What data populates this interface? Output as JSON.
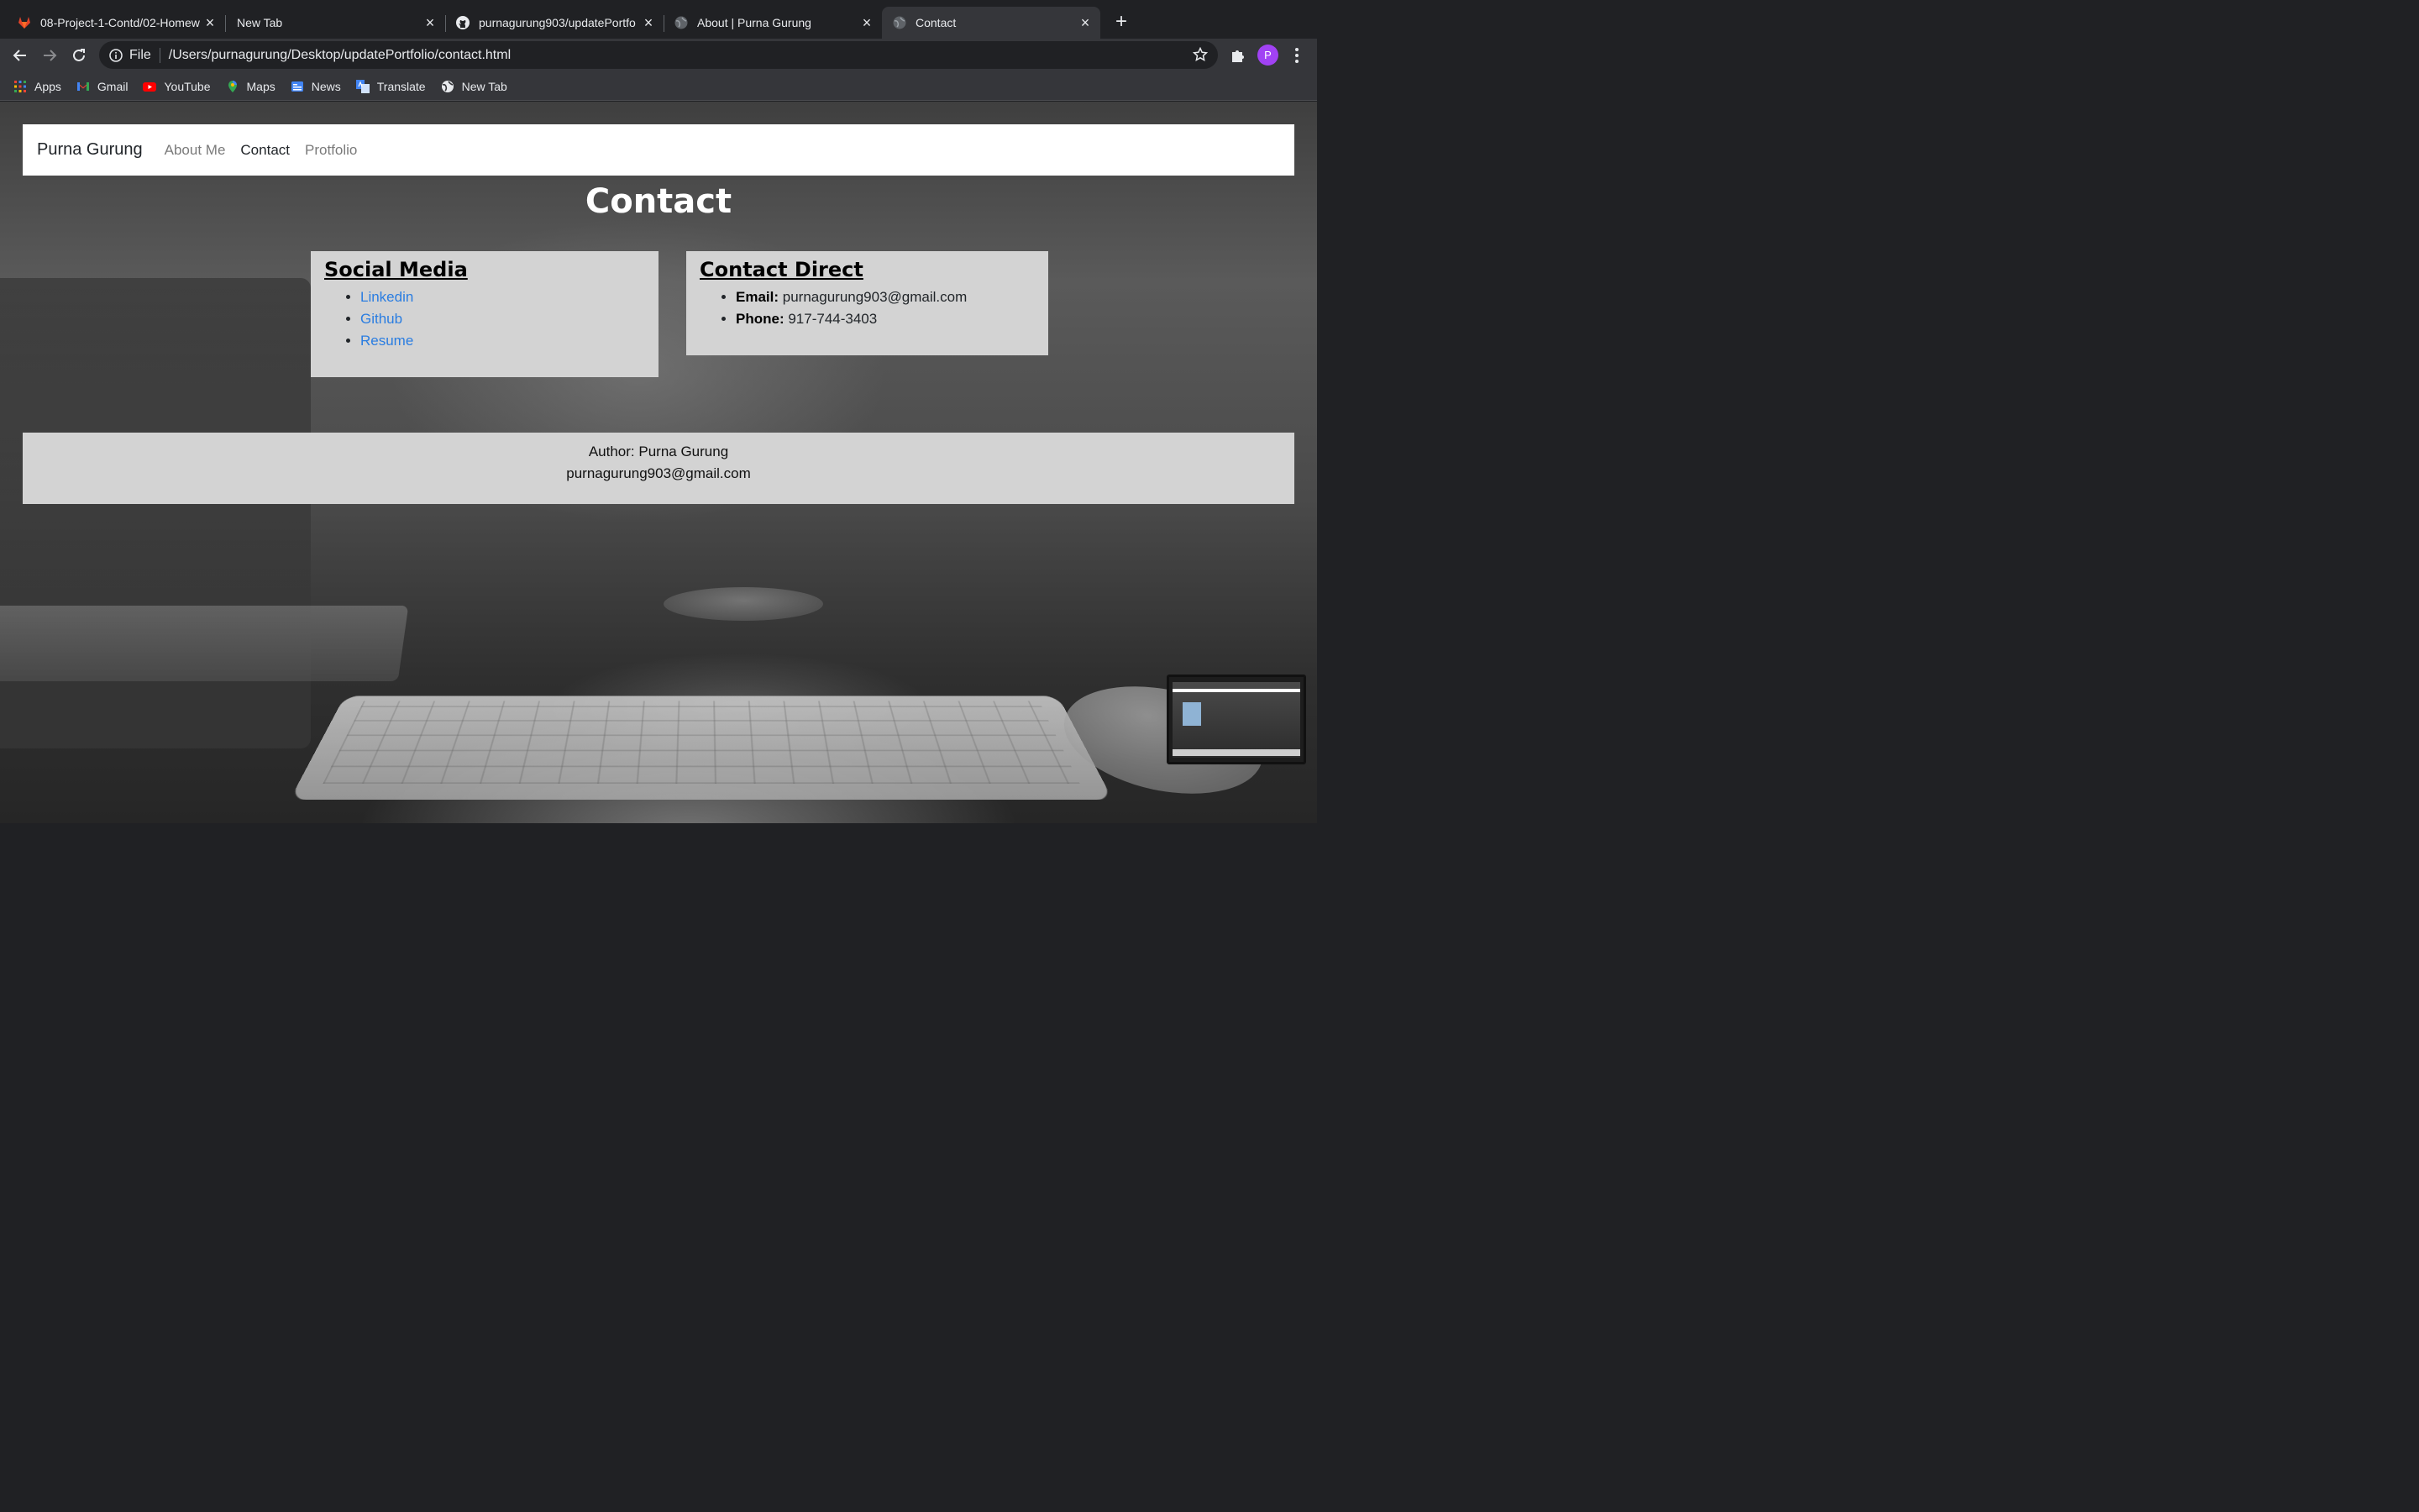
{
  "browser": {
    "tabs": [
      {
        "title": "08-Project-1-Contd/02-Homew",
        "icon": "gitlab-icon"
      },
      {
        "title": "New Tab",
        "icon": ""
      },
      {
        "title": "purnagurung903/updatePortfo",
        "icon": "github-icon"
      },
      {
        "title": "About | Purna Gurung",
        "icon": "globe-icon"
      },
      {
        "title": "Contact",
        "icon": "globe-icon"
      }
    ],
    "address": {
      "scheme": "File",
      "url": "/Users/purnagurung/Desktop/updatePortfolio/contact.html"
    },
    "profile_initial": "P",
    "bookmarks": [
      {
        "label": "Apps",
        "icon": "apps-grid-icon"
      },
      {
        "label": "Gmail",
        "icon": "gmail-icon"
      },
      {
        "label": "YouTube",
        "icon": "youtube-icon"
      },
      {
        "label": "Maps",
        "icon": "maps-pin-icon"
      },
      {
        "label": "News",
        "icon": "news-icon"
      },
      {
        "label": "Translate",
        "icon": "translate-icon"
      },
      {
        "label": "New Tab",
        "icon": "globe-icon"
      }
    ]
  },
  "site": {
    "brand": "Purna Gurung",
    "nav": [
      {
        "label": "About Me",
        "active": false
      },
      {
        "label": "Contact",
        "active": true
      },
      {
        "label": "Protfolio",
        "active": false
      }
    ],
    "title": "Contact",
    "social": {
      "heading": "Social Media",
      "links": [
        "Linkedin",
        "Github",
        "Resume"
      ]
    },
    "contact": {
      "heading": "Contact Direct",
      "email_label": "Email:",
      "email": "purnagurung903@gmail.com",
      "phone_label": "Phone:",
      "phone": "917-744-3403"
    },
    "footer": {
      "author": "Author: Purna Gurung",
      "email": "purnagurung903@gmail.com"
    }
  },
  "colors": {
    "link": "#2a7de1",
    "card_bg": "#d3d3d3",
    "tab_active_bg": "#35363a",
    "tabstrip_bg": "#202124",
    "avatar_bg": "#a142f4"
  }
}
